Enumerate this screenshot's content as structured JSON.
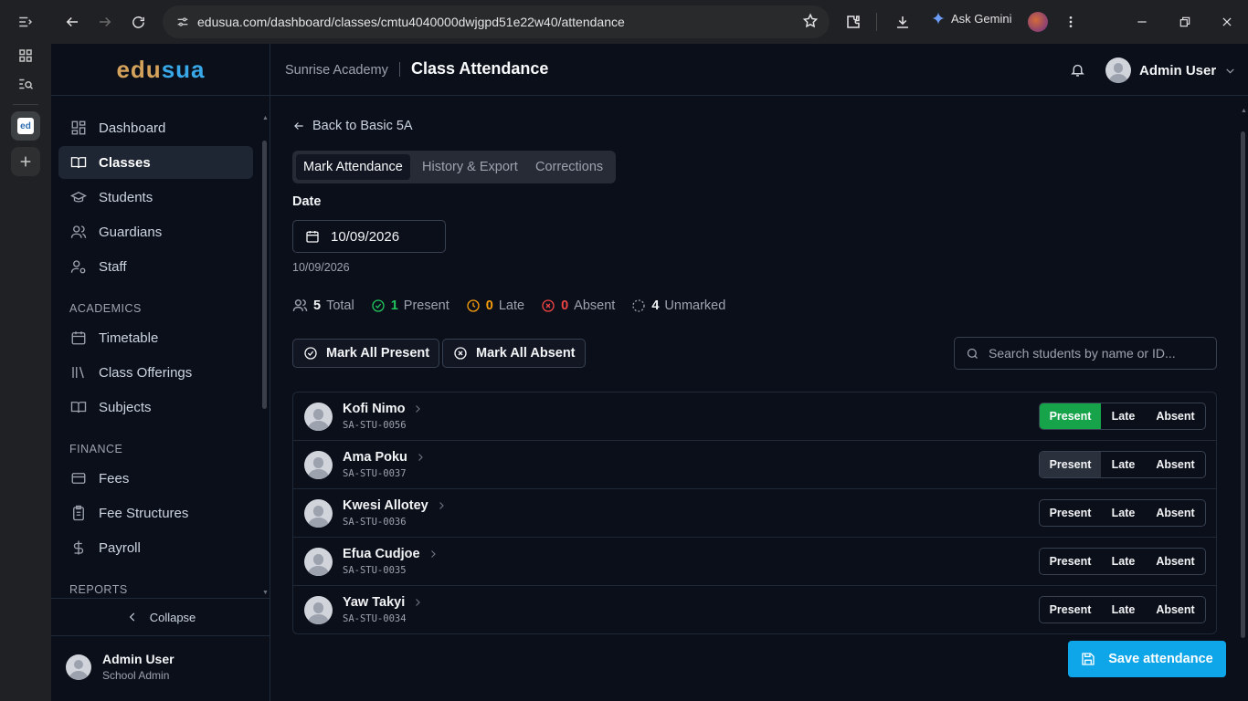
{
  "browser": {
    "url": "edusua.com/dashboard/classes/cmtu4040000dwjgpd51e22w40/attendance",
    "gemini_label": "Ask Gemini",
    "favicon_text": "ed"
  },
  "logo": {
    "part1": "edu",
    "part2": "sua"
  },
  "sidebar": {
    "items": [
      {
        "label": "Dashboard",
        "icon": "dashboard-icon"
      },
      {
        "label": "Classes",
        "icon": "book-open-icon",
        "active": true
      },
      {
        "label": "Students",
        "icon": "graduation-cap-icon"
      },
      {
        "label": "Guardians",
        "icon": "users-icon"
      },
      {
        "label": "Staff",
        "icon": "user-cog-icon"
      }
    ],
    "academics_heading": "ACADEMICS",
    "academics": [
      {
        "label": "Timetable",
        "icon": "calendar-icon"
      },
      {
        "label": "Class Offerings",
        "icon": "library-icon"
      },
      {
        "label": "Subjects",
        "icon": "book-icon"
      }
    ],
    "finance_heading": "FINANCE",
    "finance": [
      {
        "label": "Fees",
        "icon": "wallet-icon"
      },
      {
        "label": "Fee Structures",
        "icon": "clipboard-icon"
      },
      {
        "label": "Payroll",
        "icon": "dollar-icon"
      }
    ],
    "reports_heading": "REPORTS",
    "collapse_label": "Collapse",
    "user": {
      "name": "Admin User",
      "role": "School Admin"
    }
  },
  "header": {
    "school": "Sunrise Academy",
    "title": "Class Attendance",
    "user": "Admin User"
  },
  "main": {
    "back_label": "Back to Basic 5A",
    "tabs": [
      "Mark Attendance",
      "History & Export",
      "Corrections"
    ],
    "date_label": "Date",
    "date_value": "10/09/2026",
    "date_sub": "10/09/2026",
    "stats": {
      "total": "5",
      "total_label": "Total",
      "present": "1",
      "present_label": "Present",
      "late": "0",
      "late_label": "Late",
      "absent": "0",
      "absent_label": "Absent",
      "unmarked": "4",
      "unmarked_label": "Unmarked"
    },
    "mark_all_present": "Mark All Present",
    "mark_all_absent": "Mark All Absent",
    "search_placeholder": "Search students by name or ID...",
    "status_labels": {
      "present": "Present",
      "late": "Late",
      "absent": "Absent"
    },
    "students": [
      {
        "name": "Kofi Nimo",
        "id": "SA-STU-0056",
        "status": "present"
      },
      {
        "name": "Ama Poku",
        "id": "SA-STU-0037",
        "status": "none"
      },
      {
        "name": "Kwesi Allotey",
        "id": "SA-STU-0036",
        "status": "none"
      },
      {
        "name": "Efua Cudjoe",
        "id": "SA-STU-0035",
        "status": "none"
      },
      {
        "name": "Yaw Takyi",
        "id": "SA-STU-0034",
        "status": "none"
      }
    ],
    "save_label": "Save attendance"
  },
  "colors": {
    "accent": "#0ea5e9",
    "present": "#16a34a",
    "late": "#f59e0b",
    "absent": "#ef4444",
    "logo_edu": "#d4a25a",
    "logo_sua": "#38a8e8"
  }
}
